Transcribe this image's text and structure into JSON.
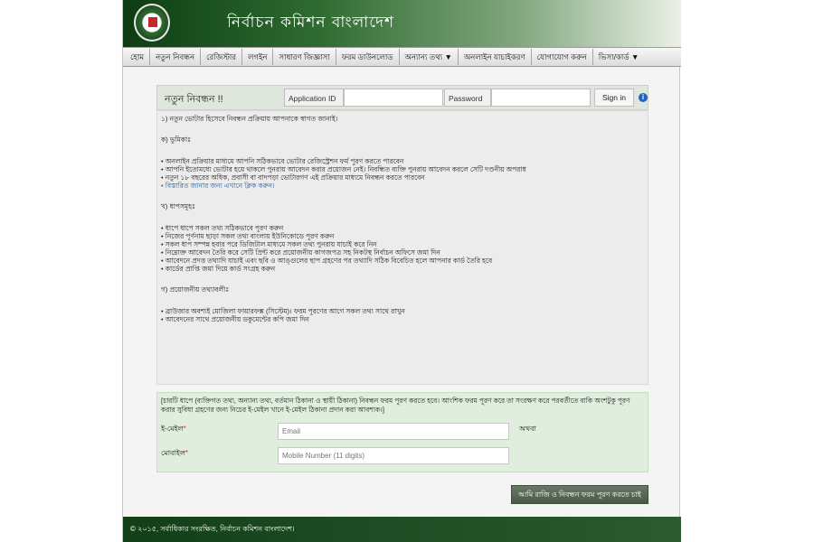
{
  "header": {
    "title": "নির্বাচন কমিশন বাংলাদেশ",
    "logo_icon": "election-commission-logo"
  },
  "nav": {
    "items": [
      "হোম",
      "নতুন নিবন্ধন",
      "রেজিস্টার",
      "লগইন",
      "সাধারণ জিজ্ঞাসা",
      "ফরম ডাউনলোড",
      "অন্যান্য তথ্য ▼",
      "অনলাইন যাচাইকরণ",
      "যোগাযোগ করুন",
      "ভিসা/কার্ড ▼"
    ]
  },
  "login": {
    "section_title": "নতুন নিবন্ধন !!",
    "application_id_label": "Application ID",
    "password_label": "Password",
    "signin_label": "Sign in",
    "info_icon": "i"
  },
  "instructions": {
    "intro": "১) নতুন ভোটার হিসেবে নিবন্ধন প্রক্রিয়ায় আপনাকে স্বাগত জানাই।",
    "section_ka_title": "ক) ভূমিকাঃ",
    "section_ka_items": [
      "অনলাইন প্রক্রিয়ার মাধ্যমে আপনি সঠিকভাবে ভোটার রেজিস্ট্রেশন ফর্ম পূরণ করতে পারবেন",
      "আপনি ইতোমধ্যে ভোটার হয়ে থাকলে পুনরায় আবেদন করার প্রয়োজন নেই। নিবন্ধিত ব্যক্তি পুনরায় আবেদন করলে সেটি দণ্ডনীয় অপরাধ",
      "নতুন ১৮ বছরের অধিক, প্রবাসী বা বাদপড়া ভোটারগণ এই প্রক্রিয়ার মাধ্যমে নিবন্ধন করতে পারবেন",
      "বিস্তারিত জানার জন্য এখানে ক্লিক করুন।"
    ],
    "section_kha_title": "খ) ধাপসমূহঃ",
    "section_kha_items": [
      "ধাপে ধাপে সকল তথ্য সঠিকভাবে পূরণ করুন",
      "নিজের পূর্ণনাম ছাড়া সকল তথ্য বাংলায় ইউনিকোডে পূরণ করুন",
      "সকল ধাপ সম্পন্ন হবার পরে ডিজিটাল মাধ্যমে সকল তথ্য পুনরায় যাচাই করে নিন",
      "নিম্নোক্ত আবেদন তৈরি করে সেটি প্রিন্ট করে প্রয়োজনীয় কাগজপত্র সহ নিকটস্থ নির্বাচন অফিসে জমা দিন",
      "আবেদনে প্রদত্ত তথ্যাদি যাচাই এবং ছবি ও আঙ্গুলের ছাপ গ্রহণের পর তথ্যাদি সঠিক বিবেচিত হলে আপনার কার্ড তৈরি হবে",
      "কার্ডের প্রাপ্তি জমা দিয়ে কার্ড সংগ্রহ করুন"
    ],
    "section_ga_title": "গ) প্রয়োজনীয় তথ্যাবলীঃ",
    "section_ga_items": [
      "ব্রাউজার অবশ্যই মোজিলা ফায়ারফক্স (সিস্টেম)। ফরম পূরণের আগে সকল তথ্য সাথে রাখুন",
      "আবেদনের সাথে প্রয়োজনীয় ডকুমেন্টের কপি জমা দিন"
    ]
  },
  "form": {
    "note": "[চারটি ধাপে (ব্যক্তিগত তথ্য, অন্যান্য তথ্য, বর্তমান ঠিকানা ও স্থায়ী ঠিকানা) নিবন্ধন ফরম পূরণ করতে হবে। আংশিক ফরম পূরণ করে তা সংরক্ষণ করে পরবর্তীতে বাকি অংশটুকু পূরণ করার সুবিধা গ্রহণের জন্য নিচের ই-মেইল খানে ই-মেইল ঠিকানা প্রদান করা আবশ্যক।]",
    "email_label": "ই-মেইল",
    "email_placeholder": "Email",
    "or_label": "অথবা",
    "mobile_label": "মোবাইল",
    "mobile_placeholder": "Mobile Number (11 digits)",
    "required_mark": "*",
    "submit_label": "আমি রাজি ও নিবন্ধন ফরম পূরণ করতে চাই"
  },
  "footer": {
    "text": "© ২০১৫, সর্বাধিকার সংরক্ষিত, নির্বাচন কমিশন বাংলাদেশ।"
  }
}
